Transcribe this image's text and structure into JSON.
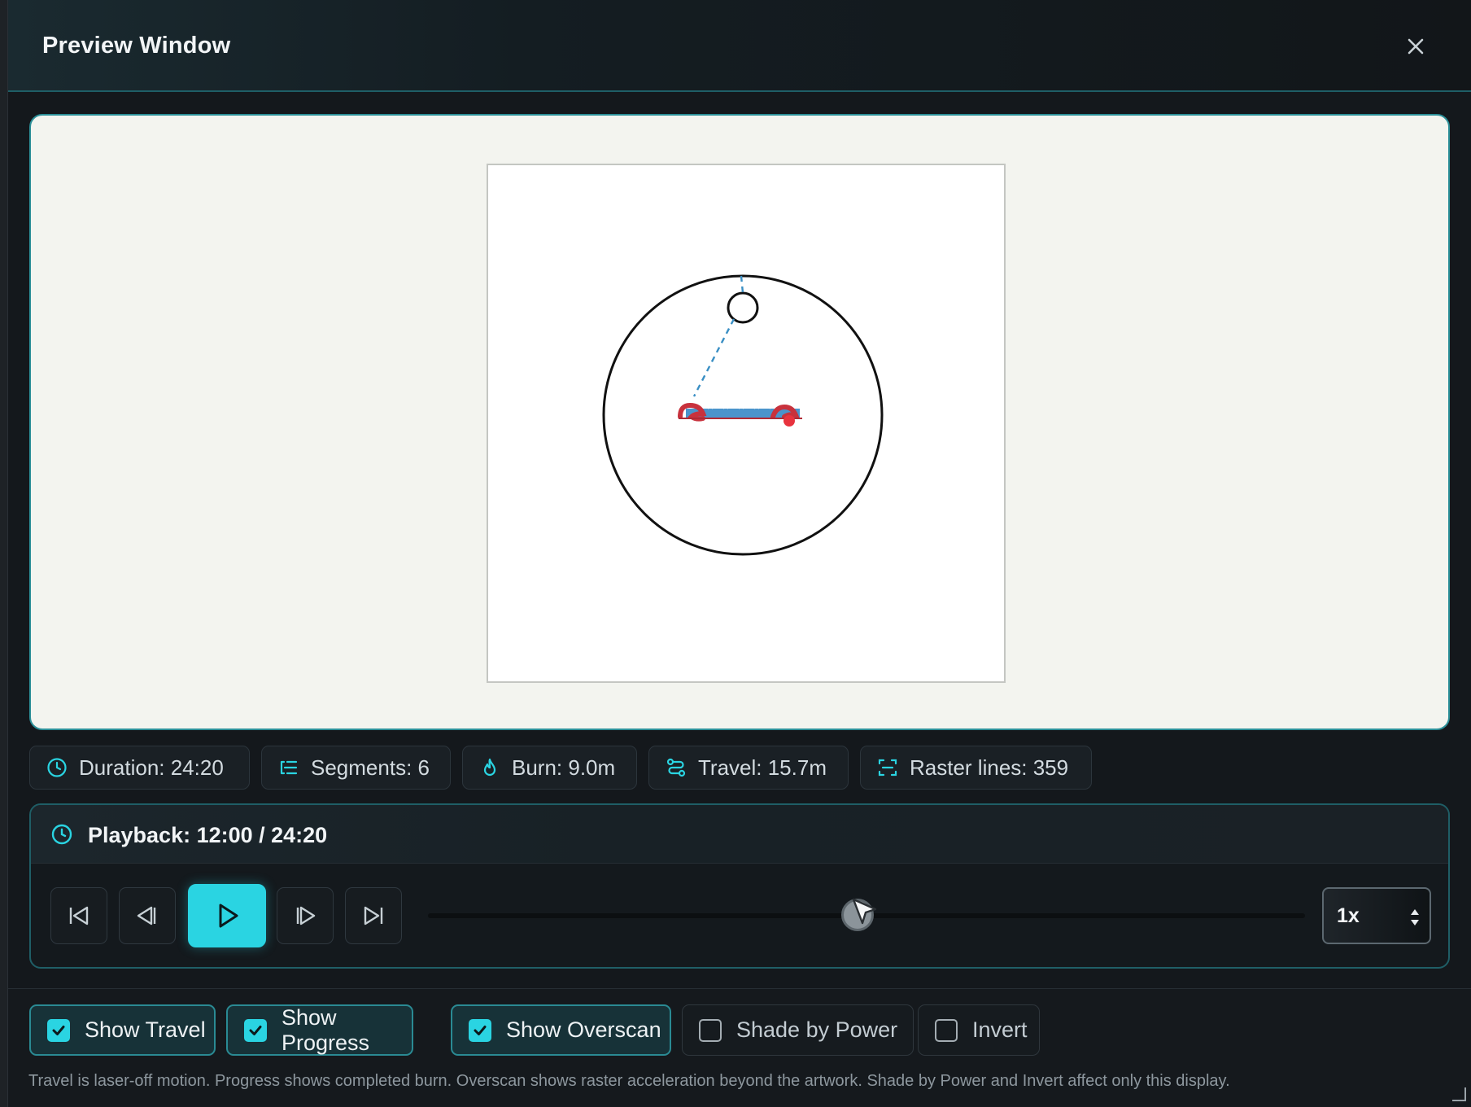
{
  "window": {
    "title": "Preview Window"
  },
  "stats": [
    {
      "icon": "clock-icon",
      "text": "Duration: 24:20"
    },
    {
      "icon": "segments-icon",
      "text": "Segments: 6"
    },
    {
      "icon": "flame-icon",
      "text": "Burn: 9.0m"
    },
    {
      "icon": "route-icon",
      "text": "Travel: 15.7m"
    },
    {
      "icon": "scan-icon",
      "text": "Raster lines: 359"
    }
  ],
  "playback": {
    "label": "Playback: 12:00 / 24:20",
    "current": "12:00",
    "total": "24:20",
    "progress_fraction": 0.49,
    "speed": "1x"
  },
  "toggles": [
    {
      "label": "Show Travel",
      "checked": true
    },
    {
      "label": "Show Progress",
      "checked": true
    },
    {
      "label": "Show Overscan",
      "checked": true
    },
    {
      "label": "Shade by Power",
      "checked": false
    },
    {
      "label": "Invert",
      "checked": false
    }
  ],
  "hint": "Travel is laser-off motion. Progress shows completed burn. Overscan shows raster acceleration beyond the artwork. Shade by Power and Invert affect only this display.",
  "colors": {
    "accent": "#2ad4e2",
    "border_accent": "#1f5e66",
    "travel_line": "#3a8fc4",
    "burn_red": "#c8323d",
    "canvas_bg": "#f3f4ef"
  }
}
